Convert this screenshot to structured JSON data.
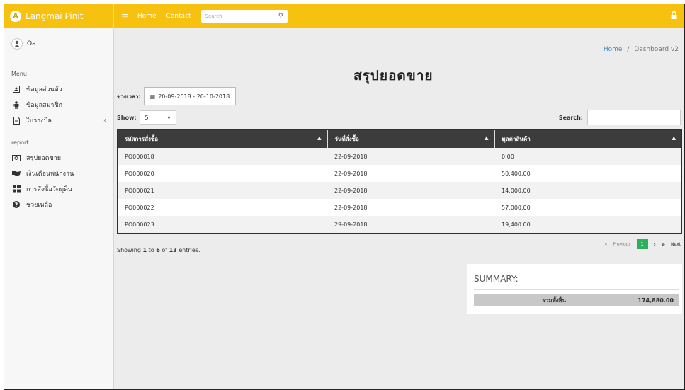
{
  "brand": {
    "logo_letter": "A",
    "name": "Langmai Pinit"
  },
  "user": {
    "name": "Oa"
  },
  "sidebar": {
    "menu_label": "Menu",
    "menu_items": [
      {
        "label": "ข้อมูลส่วนตัว",
        "icon": "id-card-icon"
      },
      {
        "label": "ข้อมูลสมาชิก",
        "icon": "person-icon"
      },
      {
        "label": "ใบวางบิล",
        "icon": "document-icon",
        "arrow": "‹"
      }
    ],
    "report_label": "report",
    "report_items": [
      {
        "label": "สรุปยอดขาย",
        "icon": "money-icon"
      },
      {
        "label": "เงินเดือนพนักงาน",
        "icon": "handshake-icon"
      },
      {
        "label": "การสั่งซื้อวัตถุดิบ",
        "icon": "grid-icon"
      },
      {
        "label": "ช่วยเหลือ",
        "icon": "help-icon"
      }
    ]
  },
  "topbar": {
    "menu_icon": "≡",
    "links": [
      "Home",
      "Contact"
    ],
    "search_placeholder": "Search",
    "search_icon": "⚲",
    "lock_icon": "🔒"
  },
  "breadcrumb": {
    "home": "Home",
    "separator": "/",
    "current": "Dashboard v2"
  },
  "page": {
    "title": "สรุปยอดขาย",
    "date_label": "ช่วงเวลา:",
    "date_icon": "▦",
    "date_range": "20-09-2018 - 20-10-2018"
  },
  "table_controls": {
    "show_label": "Show:",
    "show_value": "5",
    "show_arrow": "▾",
    "search_label": "Search:"
  },
  "table": {
    "columns": [
      "รหัสการสั่งซื้อ",
      "วันที่สั่งซื้อ",
      "มูลค่าสินค้า"
    ],
    "sort_icon": "▲",
    "rows": [
      [
        "PO000018",
        "22-09-2018",
        "0.00"
      ],
      [
        "PO000020",
        "22-09-2018",
        "50,400.00"
      ],
      [
        "PO000021",
        "22-09-2018",
        "14,000.00"
      ],
      [
        "PO000022",
        "22-09-2018",
        "57,000.00"
      ],
      [
        "PO000023",
        "29-09-2018",
        "19,400.00"
      ]
    ]
  },
  "info": {
    "prefix": "Showing ",
    "start": "1",
    "to": " to ",
    "end": "6",
    "of": " of ",
    "total": "13",
    "suffix": " entries."
  },
  "pagination": {
    "first": "«",
    "previous": "Previous",
    "current": "1",
    "next_arrow": "›",
    "last_arrow": "»",
    "next": "Next"
  },
  "summary": {
    "title": "SUMMARY:",
    "total_label": "รวมทั้งสิ้น",
    "total_value": "174,880.00"
  },
  "colors": {
    "brand": "#f7c10f",
    "header": "#3c3c3c",
    "active_page": "#2eaf5a",
    "link": "#3c8dbc"
  }
}
